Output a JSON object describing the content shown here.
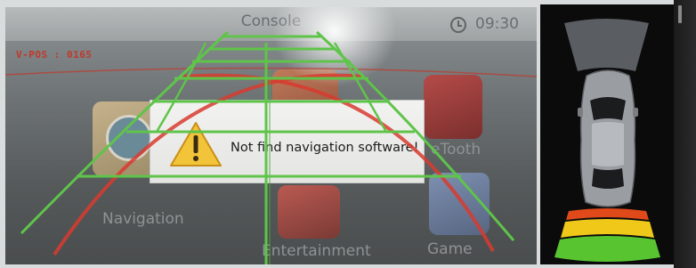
{
  "screen": {
    "title": "Console",
    "time": "09:30",
    "vpos_label": "V-POS : 0165"
  },
  "apps": [
    {
      "label": "Navigation"
    },
    {
      "label": "eTooth"
    },
    {
      "label": "Entertainment"
    },
    {
      "label": "Game"
    }
  ],
  "dialog": {
    "message": "Not find navigation software!",
    "icon": "warning-icon"
  },
  "parking_sensor": {
    "icons": [
      "car-icon"
    ],
    "zone_colors": [
      "#e04a1a",
      "#f0c81a",
      "#58c430"
    ]
  },
  "colors": {
    "guide_green": "#5fc44a",
    "guide_red": "#d83b2f",
    "vpos_red": "#c0392b"
  }
}
